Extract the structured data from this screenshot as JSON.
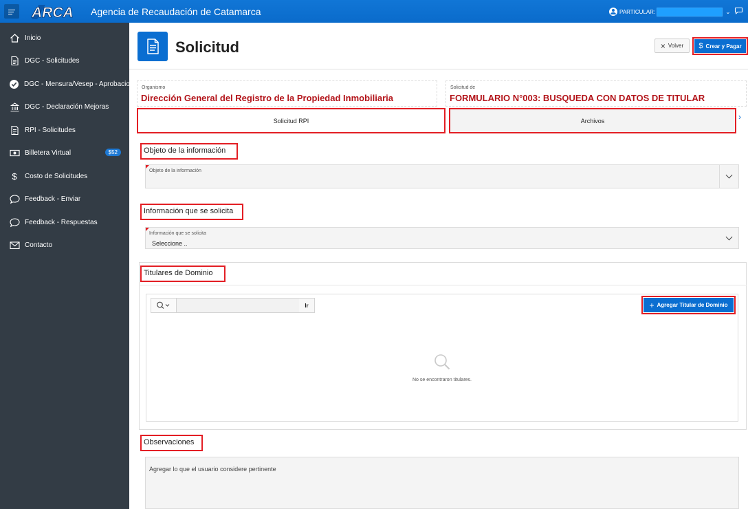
{
  "header": {
    "logo_text": "ARCA",
    "app_title": "Agencia de Recaudación de Catamarca",
    "user_label": "PARTICULAR:"
  },
  "sidebar": {
    "items": [
      {
        "label": "Inicio",
        "icon": "home-icon"
      },
      {
        "label": "DGC - Solicitudes",
        "icon": "document-icon"
      },
      {
        "label": "DGC - Mensura/Vesep - Aprobaciones",
        "icon": "check-circle-icon"
      },
      {
        "label": "DGC - Declaración Mejoras",
        "icon": "building-icon"
      },
      {
        "label": "RPI - Solicitudes",
        "icon": "document-icon"
      },
      {
        "label": "Billetera Virtual",
        "icon": "money-icon",
        "badge": "$52"
      },
      {
        "label": "Costo de Solicitudes",
        "icon": "dollar-icon"
      },
      {
        "label": "Feedback - Enviar",
        "icon": "comment-icon"
      },
      {
        "label": "Feedback - Respuestas",
        "icon": "comment-icon"
      },
      {
        "label": "Contacto",
        "icon": "envelope-icon"
      }
    ]
  },
  "page": {
    "title": "Solicitud",
    "back_label": "Volver",
    "create_pay_label": "Crear y Pagar"
  },
  "organismo": {
    "label": "Organismo",
    "value": "Dirección General del Registro de la Propiedad Inmobiliaria"
  },
  "solicitud_de": {
    "label": "Solicitud de",
    "value": "FORMULARIO N°003: BUSQUEDA CON DATOS DE TITULAR"
  },
  "tabs": [
    {
      "label": "Solicitud RPI",
      "active": true
    },
    {
      "label": "Archivos",
      "active": false
    }
  ],
  "sections": {
    "objeto": {
      "heading": "Objeto de la información",
      "field_label": "Objeto de la información",
      "value": ""
    },
    "informacion": {
      "heading": "Información que se solicita",
      "field_label": "Información que se solicita",
      "value": "Seleccione .."
    },
    "titulares": {
      "heading": "Titulares de Dominio",
      "search_value": "",
      "go_label": "Ir",
      "add_label": "Agregar Titular de Dominio",
      "empty_message": "No se encontraron titulares."
    },
    "observaciones": {
      "heading": "Observaciones",
      "placeholder": "Agregar lo que el usuario considere pertinente"
    }
  },
  "colors": {
    "primary": "#0a6ed1",
    "sidebar_bg": "#333c45",
    "highlight_red": "#e31e24",
    "value_red": "#b3141a"
  }
}
